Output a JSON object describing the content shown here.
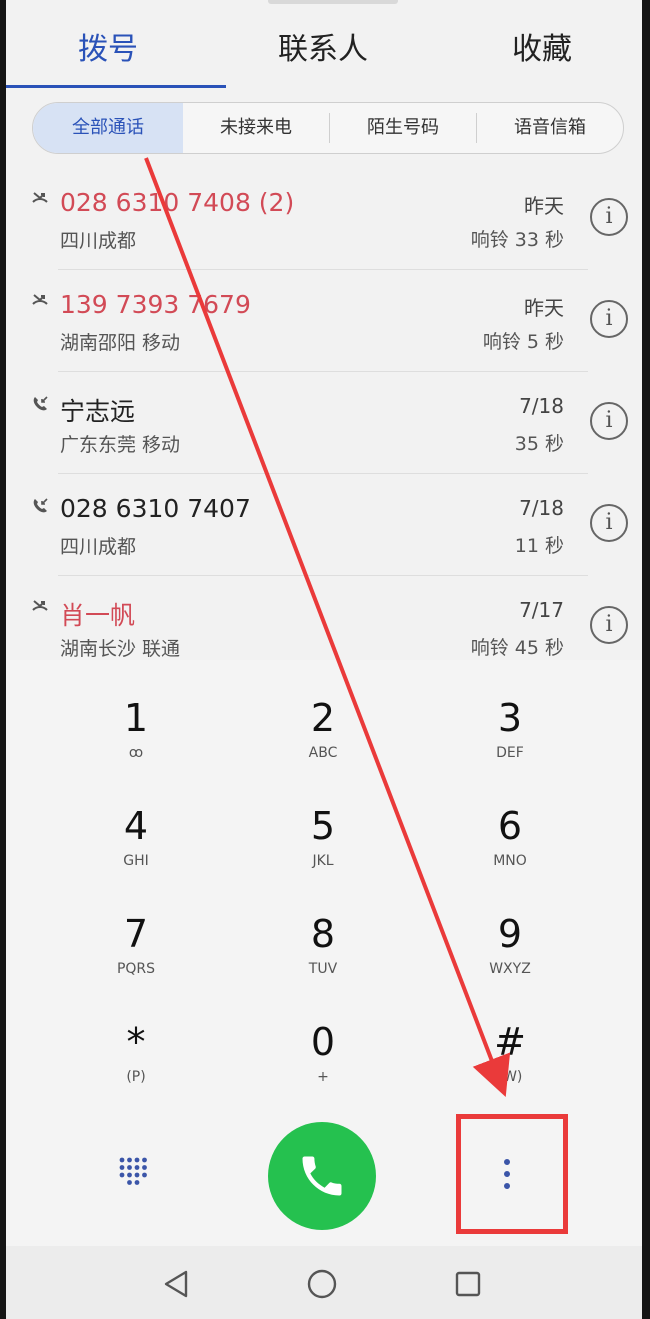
{
  "tabs": [
    {
      "label": "拨号",
      "active": true
    },
    {
      "label": "联系人",
      "active": false
    },
    {
      "label": "收藏",
      "active": false
    }
  ],
  "filters": [
    {
      "label": "全部通话",
      "active": true
    },
    {
      "label": "未接来电",
      "active": false
    },
    {
      "label": "陌生号码",
      "active": false
    },
    {
      "label": "语音信箱",
      "active": false
    }
  ],
  "calls": [
    {
      "name": "028 6310 7408 (2)",
      "location": "四川成都",
      "time": "昨天",
      "duration": "响铃 33 秒",
      "type": "missed",
      "icon": "missed-call-icon"
    },
    {
      "name": "139 7393 7679",
      "location": "湖南邵阳 移动",
      "time": "昨天",
      "duration": "响铃 5 秒",
      "type": "missed",
      "icon": "missed-call-icon"
    },
    {
      "name": "宁志远",
      "location": "广东东莞 移动",
      "time": "7/18",
      "duration": "35 秒",
      "type": "received",
      "icon": "incoming-call-icon"
    },
    {
      "name": "028 6310 7407",
      "location": "四川成都",
      "time": "7/18",
      "duration": "11 秒",
      "type": "received",
      "icon": "incoming-call-icon"
    },
    {
      "name": "肖一帆",
      "location": "湖南长沙 联通",
      "time": "7/17",
      "duration": "响铃 45 秒",
      "type": "missed",
      "icon": "missed-call-icon"
    }
  ],
  "dialpad": {
    "keys": [
      {
        "digit": "1",
        "letters": "ꝏ"
      },
      {
        "digit": "2",
        "letters": "ABC"
      },
      {
        "digit": "3",
        "letters": "DEF"
      },
      {
        "digit": "4",
        "letters": "GHI"
      },
      {
        "digit": "5",
        "letters": "JKL"
      },
      {
        "digit": "6",
        "letters": "MNO"
      },
      {
        "digit": "7",
        "letters": "PQRS"
      },
      {
        "digit": "8",
        "letters": "TUV"
      },
      {
        "digit": "9",
        "letters": "WXYZ"
      },
      {
        "digit": "*",
        "letters": "(P)"
      },
      {
        "digit": "0",
        "letters": "+"
      },
      {
        "digit": "#",
        "letters": "(W)"
      }
    ]
  },
  "colors": {
    "accent": "#2a52b8",
    "missed": "#d24a56",
    "call_button": "#25c14f",
    "annotation": "#ea3a3a"
  },
  "icons": {
    "dialpad_toggle": "dialpad-grid-icon",
    "call": "phone-icon",
    "menu": "more-vertical-icon",
    "nav": [
      "back-icon",
      "home-icon",
      "recents-icon"
    ]
  }
}
